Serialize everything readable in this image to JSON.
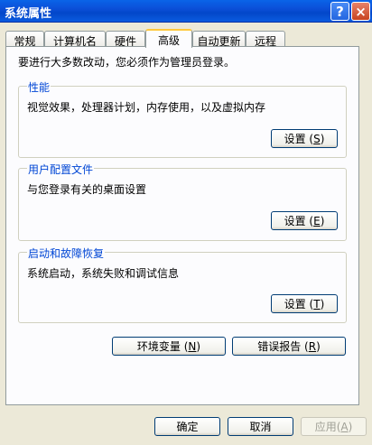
{
  "window": {
    "title": "系统属性",
    "help_glyph": "?",
    "close_glyph": "×"
  },
  "tabs": [
    {
      "label": "常规"
    },
    {
      "label": "计算机名"
    },
    {
      "label": "硬件"
    },
    {
      "label": "高级",
      "active": true
    },
    {
      "label": "自动更新"
    },
    {
      "label": "远程"
    }
  ],
  "intro": "要进行大多数改动，您必须作为管理员登录。",
  "groups": {
    "performance": {
      "label": "性能",
      "desc": "视觉效果，处理器计划，内存使用，以及虚拟内存",
      "button": "设置",
      "key": "S"
    },
    "profile": {
      "label": "用户配置文件",
      "desc": "与您登录有关的桌面设置",
      "button": "设置",
      "key": "E"
    },
    "startup": {
      "label": "启动和故障恢复",
      "desc": "系统启动，系统失败和调试信息",
      "button": "设置",
      "key": "T"
    }
  },
  "env_button": {
    "label": "环境变量",
    "key": "N"
  },
  "error_button": {
    "label": "错误报告",
    "key": "R"
  },
  "footer": {
    "ok": "确定",
    "cancel": "取消",
    "apply": {
      "label": "应用",
      "key": "A"
    }
  }
}
